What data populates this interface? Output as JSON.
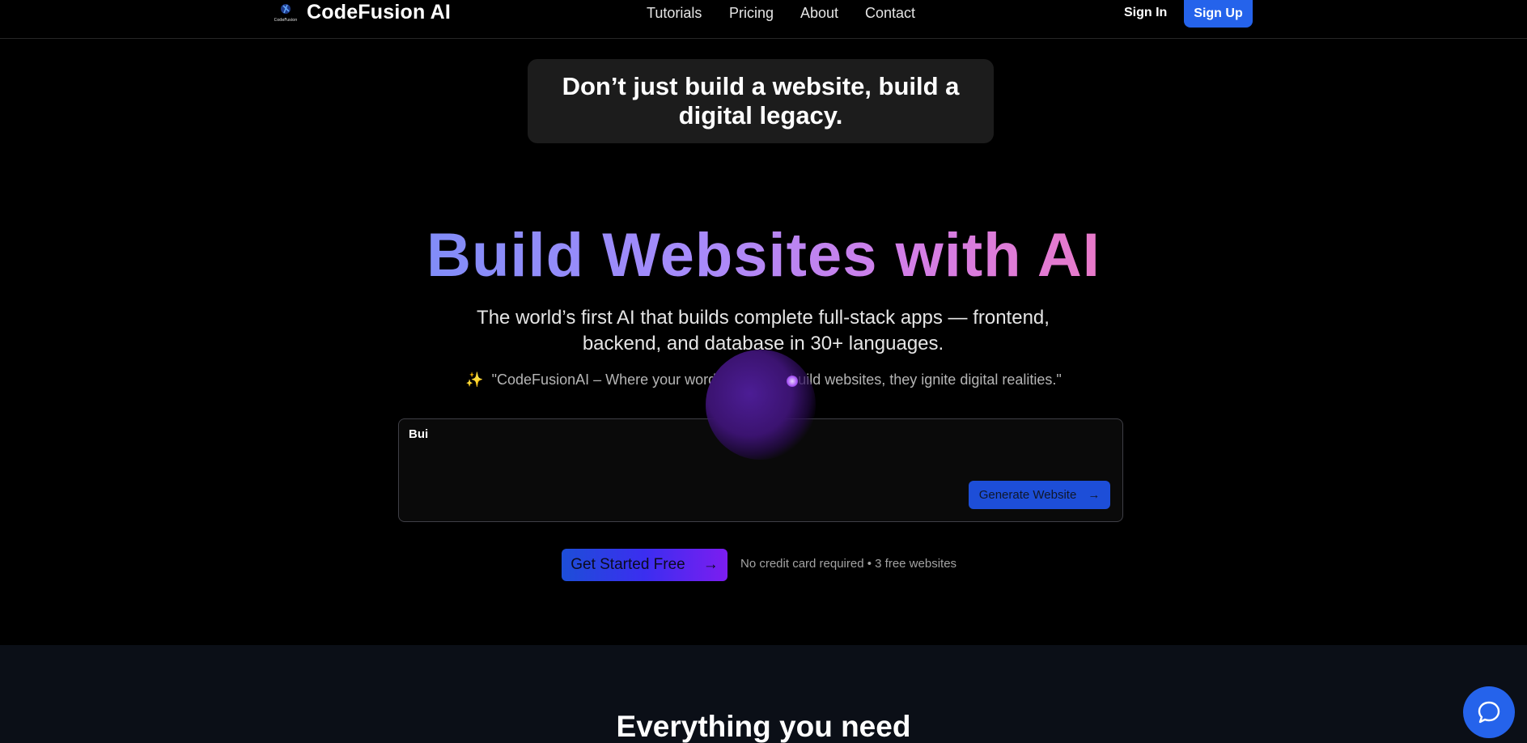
{
  "header": {
    "brand": "CodeFusion AI",
    "logo_text": "CodeFusion",
    "nav": [
      "Tutorials",
      "Pricing",
      "About",
      "Contact"
    ],
    "sign_in": "Sign In",
    "sign_up": "Sign Up"
  },
  "tagline": "Don’t just build a website, build a digital legacy.",
  "hero": {
    "title": "Build Websites with AI",
    "subtitle": "The world’s first AI that builds complete full-stack apps — frontend, backend, and database in 30+ languages.",
    "quote": "\"CodeFusionAI – Where your words don’t just build websites, they ignite digital realities.\"",
    "quote_icon": "sparkles-icon"
  },
  "prompt": {
    "value": "Bui",
    "generate_label": "Generate Website"
  },
  "cta": {
    "label": "Get Started Free",
    "note": "No credit card required • 3 free websites"
  },
  "features": {
    "title": "Everything you need"
  },
  "colors": {
    "accent": "#2563eb",
    "gradient_start": "#818cf8",
    "gradient_end": "#e879c9"
  }
}
